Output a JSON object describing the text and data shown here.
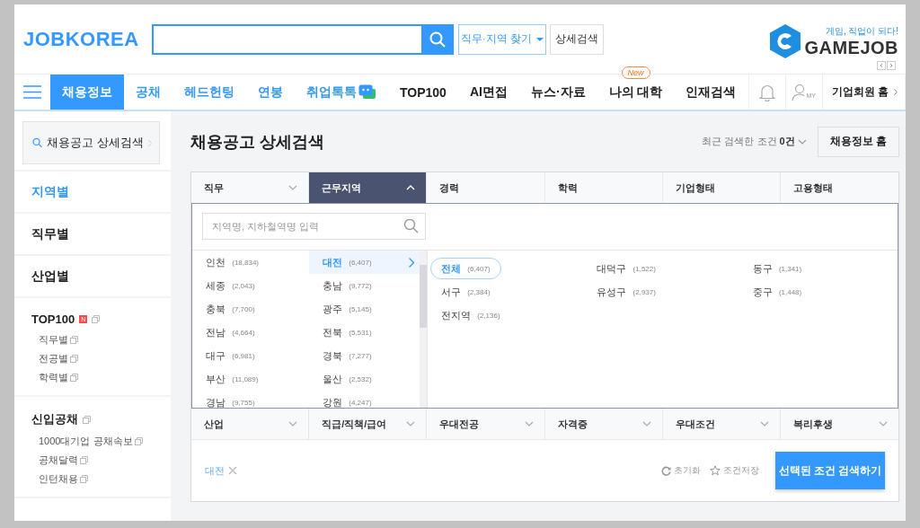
{
  "header": {
    "logo": "JOBKOREA",
    "find_button": "직무·지역 찾기",
    "detail_button": "상세검색",
    "partner": {
      "tagline": "게임, 직업이 되다!",
      "name": "GAMEJOB"
    }
  },
  "nav": {
    "items": [
      {
        "label": "채용정보",
        "selected": true,
        "color": "#3399ff"
      },
      {
        "label": "공채",
        "selected": false,
        "color": "#3399ff"
      },
      {
        "label": "헤드헌팅",
        "selected": false,
        "color": "#3399ff"
      },
      {
        "label": "연봉",
        "selected": false,
        "color": "#3399ff"
      },
      {
        "label": "취업톡톡",
        "selected": false,
        "color": "#3399ff",
        "kind": "chat"
      },
      {
        "label": "TOP100",
        "selected": false,
        "color": "#222222"
      },
      {
        "label": "AI면접",
        "selected": false,
        "color": "#222222"
      },
      {
        "label": "뉴스·자료",
        "selected": false,
        "color": "#222222"
      },
      {
        "label": "나의 대학",
        "selected": false,
        "color": "#222222",
        "badge": "New"
      },
      {
        "label": "인재검색",
        "selected": false,
        "color": "#222222"
      }
    ],
    "my_label": "MY",
    "corporate_link": "기업회원 홈"
  },
  "sidebar": {
    "search_link": "채용공고 상세검색",
    "sections": [
      {
        "title": "지역별",
        "selected": true
      },
      {
        "title": "직무별",
        "selected": false
      },
      {
        "title": "산업별",
        "selected": false
      },
      {
        "title": "TOP100",
        "selected": false,
        "badge": "N",
        "children": [
          "직무별",
          "전공별",
          "학력별"
        ]
      },
      {
        "title": "신입공채",
        "selected": false,
        "children": [
          "1000대기업 공채속보",
          "공채달력",
          "인턴채용"
        ]
      }
    ]
  },
  "main": {
    "title": "채용공고 상세검색",
    "recent_label": "최근 검색한 조건",
    "recent_count": "0건",
    "home_button": "채용정보 홈",
    "filters_top": [
      {
        "label": "직무",
        "kind": "select",
        "expanded": false
      },
      {
        "label": "근무지역",
        "kind": "select",
        "expanded": true
      },
      {
        "label": "경력",
        "kind": "plain",
        "expanded": false
      },
      {
        "label": "학력",
        "kind": "plain",
        "expanded": false
      },
      {
        "label": "기업형태",
        "kind": "plain",
        "expanded": false
      },
      {
        "label": "고용형태",
        "kind": "plain",
        "expanded": false
      }
    ],
    "region_panel": {
      "placeholder": "지역명, 지하철역명 입력",
      "regions": [
        {
          "name": "인천",
          "count": "(18,834)",
          "selected": false
        },
        {
          "name": "대전",
          "count": "(6,407)",
          "selected": true
        },
        {
          "name": "세종",
          "count": "(2,043)",
          "selected": false
        },
        {
          "name": "충남",
          "count": "(9,772)",
          "selected": false
        },
        {
          "name": "충북",
          "count": "(7,700)",
          "selected": false
        },
        {
          "name": "광주",
          "count": "(5,145)",
          "selected": false
        },
        {
          "name": "전남",
          "count": "(4,664)",
          "selected": false
        },
        {
          "name": "전북",
          "count": "(5,531)",
          "selected": false
        },
        {
          "name": "대구",
          "count": "(6,981)",
          "selected": false
        },
        {
          "name": "경북",
          "count": "(7,277)",
          "selected": false
        },
        {
          "name": "부산",
          "count": "(11,089)",
          "selected": false
        },
        {
          "name": "울산",
          "count": "(2,532)",
          "selected": false
        },
        {
          "name": "경남",
          "count": "(9,755)",
          "selected": false
        },
        {
          "name": "강원",
          "count": "(4,247)",
          "selected": false
        }
      ],
      "districts": [
        {
          "name": "전체",
          "count": "(6,407)",
          "selected": true
        },
        {
          "name": "대덕구",
          "count": "(1,522)",
          "selected": false
        },
        {
          "name": "동구",
          "count": "(1,341)",
          "selected": false
        },
        {
          "name": "서구",
          "count": "(2,384)",
          "selected": false
        },
        {
          "name": "유성구",
          "count": "(2,937)",
          "selected": false
        },
        {
          "name": "중구",
          "count": "(1,448)",
          "selected": false
        },
        {
          "name": "전지역",
          "count": "(2,136)",
          "selected": false
        }
      ]
    },
    "filters_bottom": [
      {
        "label": "산업",
        "kind": "select",
        "expanded": false
      },
      {
        "label": "직급/직책/급여",
        "kind": "select",
        "expanded": false
      },
      {
        "label": "우대전공",
        "kind": "select",
        "expanded": false
      },
      {
        "label": "자격증",
        "kind": "select",
        "expanded": false
      },
      {
        "label": "우대조건",
        "kind": "select",
        "expanded": false
      },
      {
        "label": "복리후생",
        "kind": "select",
        "expanded": false
      }
    ],
    "selected_tags": [
      "대전"
    ],
    "reset": "초기화",
    "save": "조건저장",
    "submit": "선택된 조건 검색하기"
  }
}
